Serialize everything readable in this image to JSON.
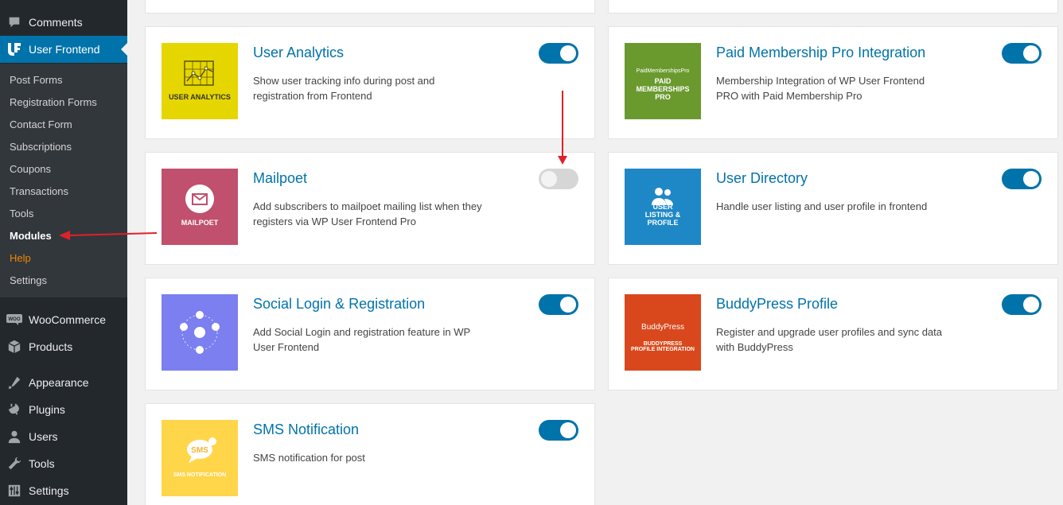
{
  "sidebar": {
    "top_items": [
      {
        "label": "Comments",
        "icon": "comments-icon"
      },
      {
        "label": "User Frontend",
        "icon": "user-frontend-icon"
      }
    ],
    "submenu": [
      {
        "label": "Post Forms"
      },
      {
        "label": "Registration Forms"
      },
      {
        "label": "Contact Form"
      },
      {
        "label": "Subscriptions"
      },
      {
        "label": "Coupons"
      },
      {
        "label": "Transactions"
      },
      {
        "label": "Tools"
      },
      {
        "label": "Modules"
      },
      {
        "label": "Help"
      },
      {
        "label": "Settings"
      }
    ],
    "bottom_items": [
      {
        "label": "WooCommerce",
        "icon": "woocommerce-icon"
      },
      {
        "label": "Products",
        "icon": "products-icon"
      },
      {
        "label": "Appearance",
        "icon": "appearance-icon"
      },
      {
        "label": "Plugins",
        "icon": "plugins-icon"
      },
      {
        "label": "Users",
        "icon": "users-icon"
      },
      {
        "label": "Tools",
        "icon": "tools-icon"
      },
      {
        "label": "Settings",
        "icon": "settings-icon"
      }
    ],
    "colors": {
      "bg": "#23282d",
      "active": "#0073aa",
      "help": "#f18500"
    }
  },
  "modules": [
    {
      "title": "User Analytics",
      "description": "Show user tracking info during post and registration from Frontend",
      "enabled": true,
      "thumb_caption": "USER ANALYTICS",
      "thumb_color": "#e6d600"
    },
    {
      "title": "Paid Membership Pro Integration",
      "description": "Membership Integration of WP User Frontend PRO with Paid Membership Pro",
      "enabled": true,
      "thumb_caption": "PAID MEMBERSHIPS PRO",
      "thumb_logo": "PaidMembershipsPro",
      "thumb_color": "#6a9a2e"
    },
    {
      "title": "Mailpoet",
      "description": "Add subscribers to mailpoet mailing list when they registers via WP User Frontend Pro",
      "enabled": false,
      "thumb_caption": "MAILPOET",
      "thumb_color": "#c0506e"
    },
    {
      "title": "User Directory",
      "description": "Handle user listing and user profile in frontend",
      "enabled": true,
      "thumb_caption": "USER LISTING & PROFILE",
      "thumb_color": "#1e88c7"
    },
    {
      "title": "Social Login & Registration",
      "description": "Add Social Login and registration feature in WP User Frontend",
      "enabled": true,
      "thumb_caption": "",
      "thumb_color": "#7b7ff0"
    },
    {
      "title": "BuddyPress Profile",
      "description": "Register and upgrade user profiles and sync data with BuddyPress",
      "enabled": true,
      "thumb_caption": "BUDDYPRESS PROFILE INTEGRATION",
      "thumb_logo": "BuddyPress",
      "thumb_color": "#d9481c"
    },
    {
      "title": "SMS Notification",
      "description": "SMS notification for post",
      "enabled": true,
      "thumb_caption": "SMS NOTIFICATION",
      "thumb_color": "#ffd54a"
    }
  ],
  "colors": {
    "accent": "#0073aa",
    "annotation_arrow": "#e0202a"
  }
}
